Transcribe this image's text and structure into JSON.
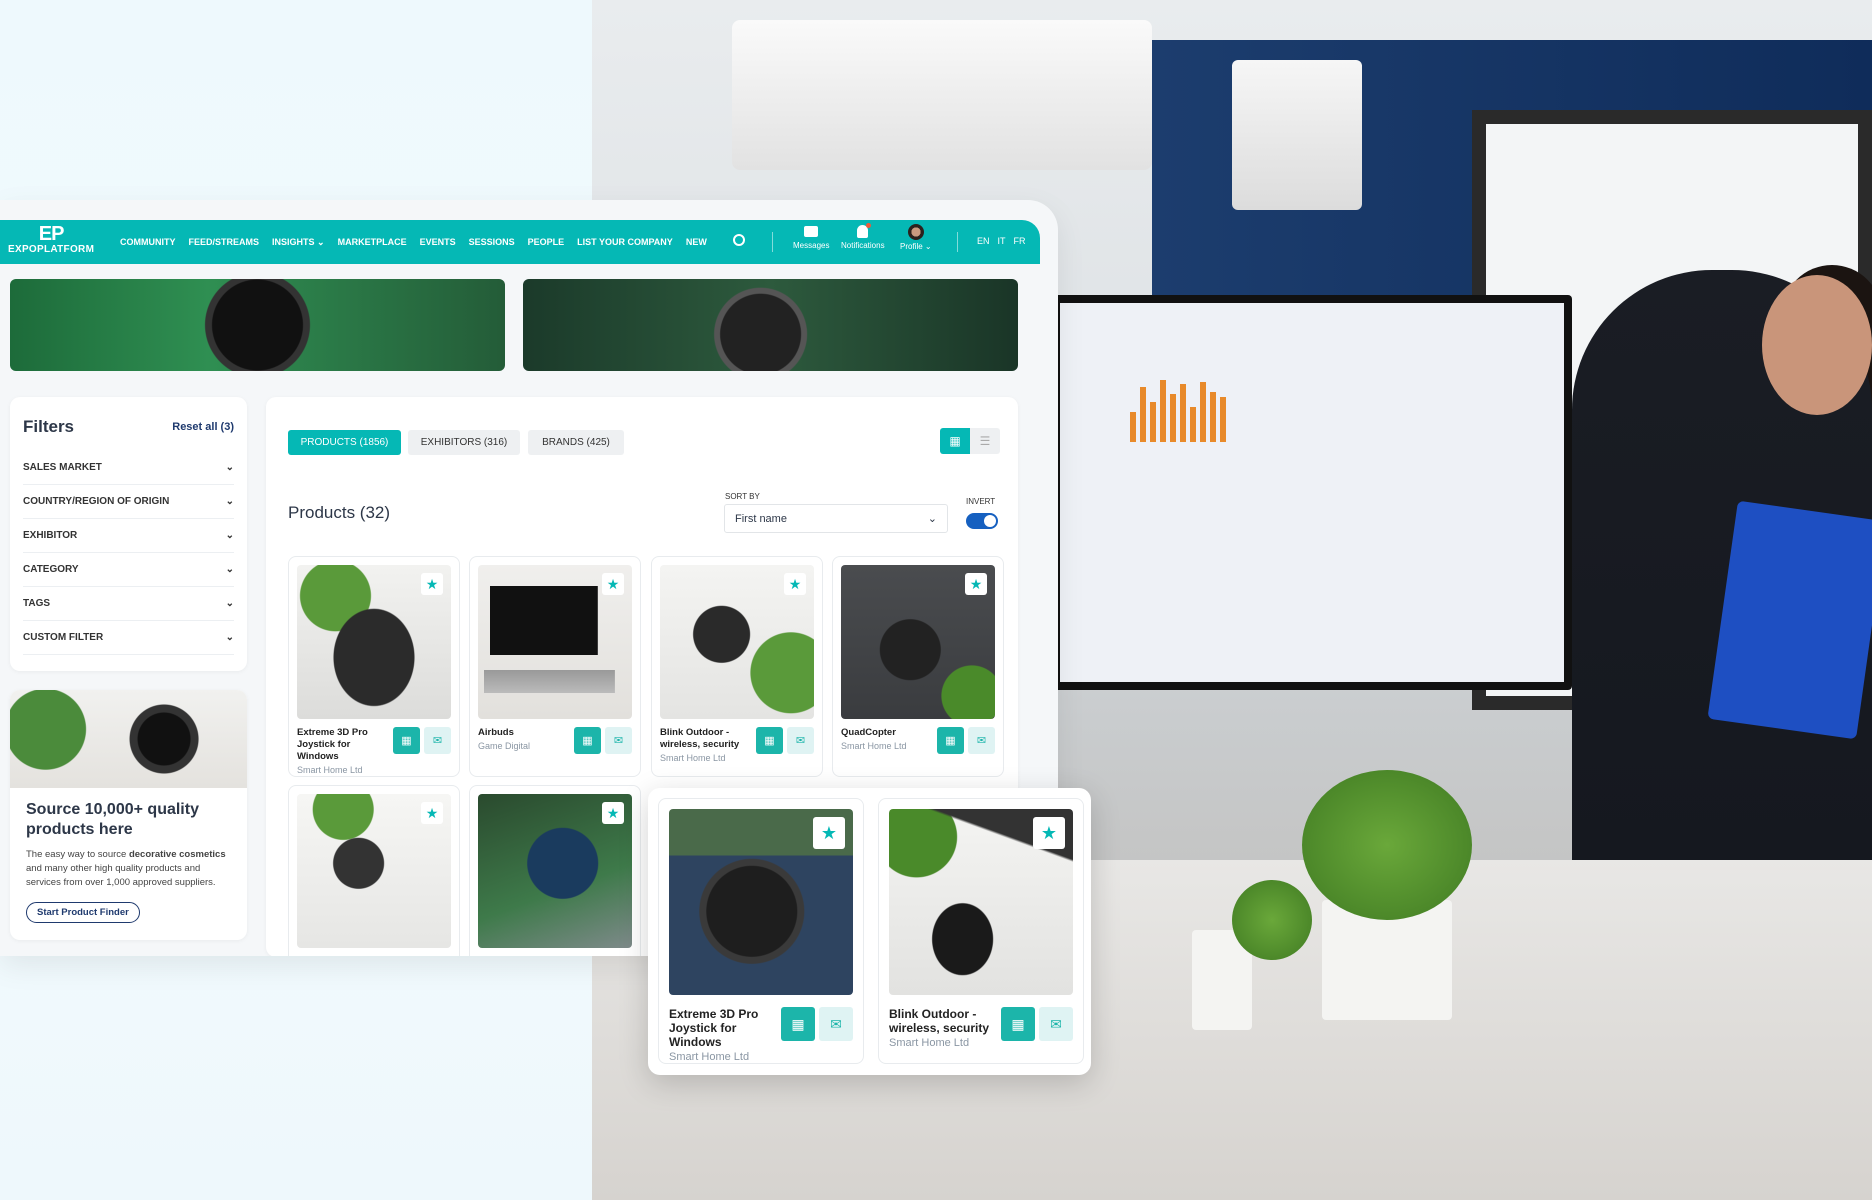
{
  "brand": {
    "logo_mark": "EP",
    "logo_text": "EXPOPLATFORM",
    "accent": "#05b8b5"
  },
  "nav": {
    "items": [
      "COMMUNITY",
      "FEED/STREAMS",
      "INSIGHTS",
      "MARKETPLACE",
      "EVENTS",
      "SESSIONS",
      "PEOPLE",
      "LIST YOUR COMPANY",
      "NEW"
    ],
    "messages": "Messages",
    "notifications": "Notifications",
    "profile": "Profile",
    "languages": [
      "EN",
      "IT",
      "FR"
    ]
  },
  "filters": {
    "title": "Filters",
    "reset": "Reset all (3)",
    "items": [
      "SALES MARKET",
      "COUNTRY/REGION OF ORIGIN",
      "EXHIBITOR",
      "CATEGORY",
      "TAGS",
      "CUSTOM FILTER"
    ]
  },
  "promo": {
    "title": "Source 10,000+ quality products here",
    "text_before": "The easy way to source ",
    "text_bold": "decorative cosmetics",
    "text_after": " and many other high quality products and services from over 1,000 approved suppliers.",
    "button": "Start Product Finder"
  },
  "tabs": [
    {
      "label": "PRODUCTS (1856)",
      "active": true
    },
    {
      "label": "EXHIBITORS (316)",
      "active": false
    },
    {
      "label": "BRANDS (425)",
      "active": false
    }
  ],
  "view": {
    "mode": "grid"
  },
  "products": {
    "title": "Products (32)",
    "sort_label": "SORT BY",
    "sort_value": "First name",
    "invert_label": "INVERT",
    "invert_on": true,
    "items": [
      {
        "name": "Extreme 3D Pro Joystick for Windows",
        "company": "Smart Home Ltd"
      },
      {
        "name": "Airbuds",
        "company": "Game Digital"
      },
      {
        "name": "Blink Outdoor - wireless, security",
        "company": "Smart Home Ltd"
      },
      {
        "name": "QuadCopter",
        "company": "Smart Home Ltd"
      }
    ]
  },
  "popup": {
    "items": [
      {
        "name": "Extreme 3D Pro Joystick for Windows",
        "company": "Smart Home Ltd"
      },
      {
        "name": "Blink Outdoor - wireless, security",
        "company": "Smart Home Ltd"
      }
    ]
  }
}
